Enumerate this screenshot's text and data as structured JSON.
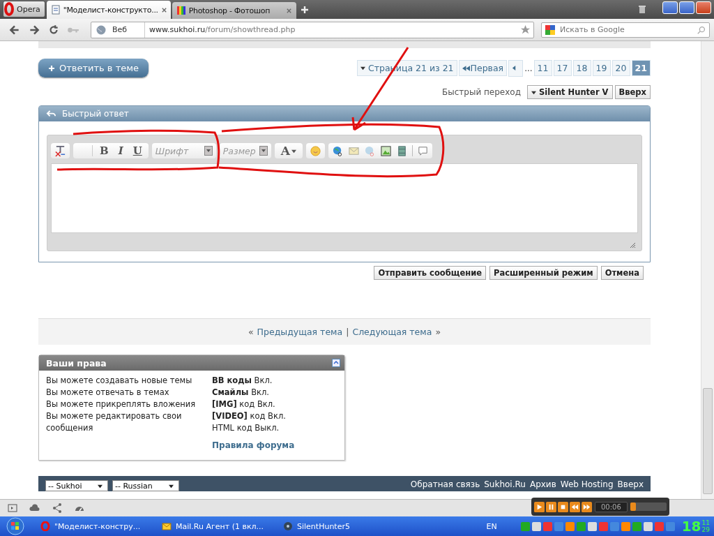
{
  "browser": {
    "menu_label": "Opera",
    "tabs": [
      {
        "label": "\"Моделист-конструкто...",
        "selected": true,
        "kind": "page"
      },
      {
        "label": "Photoshop - Фотошоп",
        "selected": false,
        "kind": "rainbow"
      }
    ],
    "scope": "Веб",
    "address": {
      "host": "www.sukhoi.ru",
      "path": "/forum/showthread.php"
    },
    "search": {
      "placeholder": "Искать в Google"
    }
  },
  "reply_button": "Ответить в теме",
  "pagination": {
    "label": "Страница 21 из 21",
    "first": "Первая",
    "ellipsis": "...",
    "pages": [
      {
        "label": "11",
        "selected": false
      },
      {
        "label": "17",
        "selected": false
      },
      {
        "label": "18",
        "selected": false
      },
      {
        "label": "19",
        "selected": false
      },
      {
        "label": "20",
        "selected": false
      },
      {
        "label": "21",
        "selected": true
      }
    ]
  },
  "quick_nav": {
    "label": "Быстрый переход",
    "select": "Silent Hunter V",
    "top": "Вверх"
  },
  "quick_reply": {
    "title": "Быстрый ответ",
    "bold": "B",
    "italic": "I",
    "underline": "U",
    "font": {
      "placeholder": "Шрифт"
    },
    "size": {
      "placeholder": "Размер"
    },
    "color_glyph": "A",
    "buttons": [
      "Отправить сообщение",
      "Расширенный режим",
      "Отмена"
    ]
  },
  "thread_nav": {
    "open": "«",
    "prev": "Предыдущая тема",
    "sep": "|",
    "next": "Следующая тема",
    "close": "»"
  },
  "rights": {
    "title": "Ваши права",
    "items": [
      "Вы можете создавать новые темы",
      "Вы можете отвечать в темах",
      "Вы можете прикреплять вложения",
      "Вы можете редактировать свои сообщения"
    ],
    "codes": [
      "**BB коды** Вкл.",
      "**Смайлы** Вкл.",
      "**[IMG]** код Вкл.",
      "**[VIDEO]** код Вкл.",
      "HTML код Выкл."
    ],
    "rules": "Правила форума"
  },
  "footer": {
    "selects": [
      "-- Sukhoi",
      "-- Russian"
    ],
    "links": [
      "Обратная связь",
      "Sukhoi.Ru",
      "Архив",
      "Web Hosting",
      "Вверх"
    ]
  },
  "player": {
    "time": "00:06",
    "level": 0.15
  },
  "taskbar": {
    "items": [
      {
        "label": "\"Моделист-констру...",
        "kind": "opera"
      },
      {
        "label": "Mail.Ru Агент (1 вкл...",
        "kind": "mail"
      },
      {
        "label": "SilentHunter5",
        "kind": "disc"
      }
    ],
    "language": "EN",
    "clock": {
      "hour": "18",
      "minute": "11",
      "second": "29"
    }
  }
}
